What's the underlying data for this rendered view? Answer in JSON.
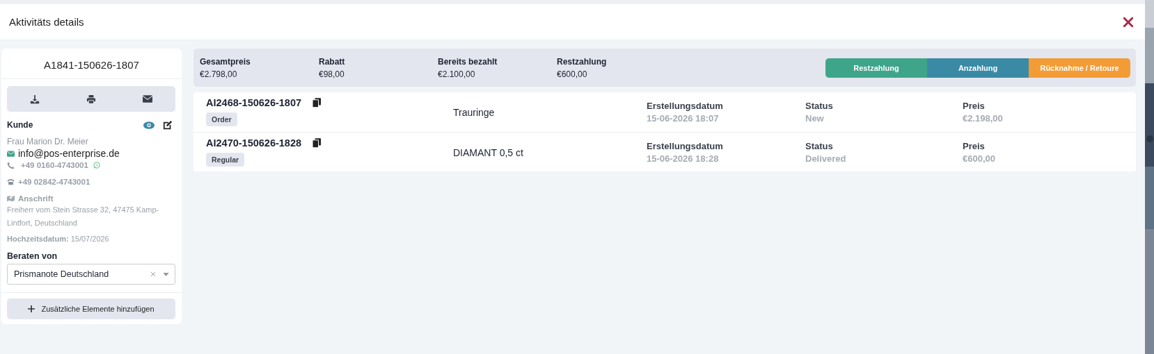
{
  "window": {
    "title": "Aktivitäts details"
  },
  "activity": {
    "number": "A1841-150626-1807"
  },
  "customer": {
    "heading": "Kunde",
    "name": "Frau Marion Dr. Meier",
    "email": "info@pos-enterprise.de",
    "mobile": "+49 0160-4743001",
    "landline": "+49 02842-4743001",
    "address_label": "Anschrift",
    "address": "Freiherr vom Stein Strasse 32, 47475 Kamp-Lintfort, Deutschland",
    "wedding": "**Hochzeitsdatum:** 15/07/2026"
  },
  "advisor": {
    "label": "Beraten von",
    "value": "Prismanote Deutschland"
  },
  "add_button": {
    "label": "Zusätzliche Elemente hinzufügen"
  },
  "summary": [
    {
      "label": "Gesamtpreis",
      "value": "€2.798,00"
    },
    {
      "label": "Rabatt",
      "value": "€98,00"
    },
    {
      "label": "Bereits bezahlt",
      "value": "€2.100,00"
    },
    {
      "label": "Restzahlung",
      "value": "€600,00"
    }
  ],
  "actions": [
    {
      "label": "Restzahlung",
      "color": "#3fa58a"
    },
    {
      "label": "Anzahlung",
      "color": "#3a8aa5"
    },
    {
      "label": "Rücknahme / Retoure",
      "color": "#f39c36"
    }
  ],
  "items": [
    {
      "number": "AI2468-150626-1807",
      "tag": "Order",
      "name": "Trauringe",
      "date_label": "Erstellungsdatum",
      "date": "15-06-2026 18:07",
      "status_label": "Status",
      "status": "New",
      "price_label": "Preis",
      "price": "€2.198,00"
    },
    {
      "number": "AI2470-150626-1828",
      "tag": "Regular",
      "name": "DIAMANT 0,5 ct",
      "date_label": "Erstellungsdatum",
      "date": "15-06-2026 18:28",
      "status_label": "Status",
      "status": "Delivered",
      "price_label": "Preis",
      "price": "€600,00"
    }
  ]
}
